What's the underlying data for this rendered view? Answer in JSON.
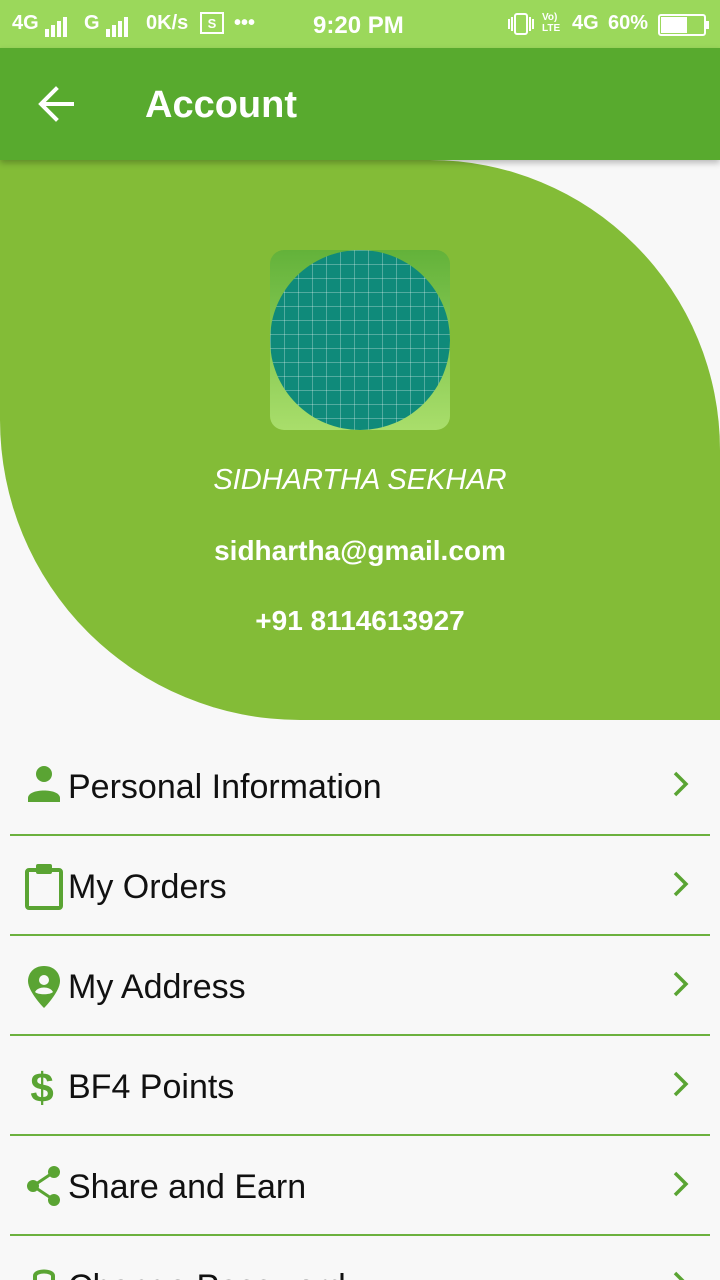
{
  "status_bar": {
    "left_network_1": "4G",
    "left_network_2": "G",
    "speed": "0K/s",
    "overflow": "•••",
    "time": "9:20 PM",
    "volte": "Vo) LTE",
    "right_network": "4G",
    "battery": "60%"
  },
  "app_bar": {
    "title": "Account",
    "back_icon": "arrow-back-icon"
  },
  "profile": {
    "name": "SIDHARTHA SEKHAR",
    "email": "sidhartha@gmail.com",
    "phone": "+91 8114613927"
  },
  "colors": {
    "primary": "#58aa2e",
    "header": "#83bc37",
    "status_bar": "#9bd85b",
    "accent_icon": "#5aa433",
    "divider": "#6cb13f"
  },
  "menu": {
    "items": [
      {
        "label": "Personal Information",
        "icon": "person-icon"
      },
      {
        "label": "My Orders",
        "icon": "clipboard-icon"
      },
      {
        "label": "My Address",
        "icon": "location-pin-icon"
      },
      {
        "label": "BF4 Points",
        "icon": "dollar-icon"
      },
      {
        "label": "Share and Earn",
        "icon": "share-icon"
      },
      {
        "label": "Change Password",
        "icon": "lock-icon"
      }
    ]
  }
}
